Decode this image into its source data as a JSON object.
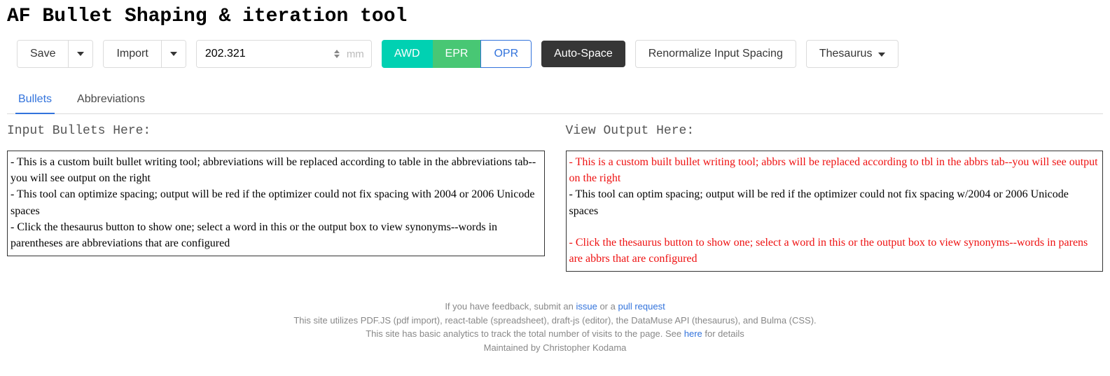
{
  "title": "AF Bullet Shaping & iteration tool",
  "toolbar": {
    "save": "Save",
    "import": "Import",
    "width_value": "202.321",
    "width_unit": "mm",
    "seg": {
      "awd": "AWD",
      "epr": "EPR",
      "opr": "OPR"
    },
    "autospace": "Auto-Space",
    "renormalize": "Renormalize Input Spacing",
    "thesaurus": "Thesaurus"
  },
  "tabs": {
    "bullets": "Bullets",
    "abbrs": "Abbreviations"
  },
  "input": {
    "label": "Input Bullets Here:",
    "text": "- This is a custom built bullet writing tool; abbreviations will be replaced according to table in the abbreviations tab--you will see output on the right\n- This tool can optimize spacing; output will be red if the optimizer could not fix spacing with 2004 or 2006 Unicode spaces\n- Click the thesaurus button to show one; select a word in this or the output box to view synonyms--words in parentheses are abbreviations that are configured"
  },
  "output": {
    "label": "View Output Here:",
    "lines": [
      {
        "text": "- This is a custom built bullet writing tool; abbrs will be replaced according to tbl in the abbrs tab--you will see output on the right",
        "err": true
      },
      {
        "text": "- This tool can optim spacing; output will be red if the optimizer could not fix spacing w/2004 or 2006 Unicode spaces",
        "err": false
      },
      {
        "text": "",
        "err": false
      },
      {
        "text": "- Click the thesaurus button to show one; select a word in this or the output box to view synonyms--words in parens are abbrs that are configured",
        "err": true
      }
    ]
  },
  "footer": {
    "l1a": "If you have feedback, submit an ",
    "l1_issue": "issue",
    "l1b": " or a ",
    "l1_pr": "pull request",
    "l2": "This site utilizes PDF.JS (pdf import), react-table (spreadsheet), draft-js (editor), the DataMuse API (thesaurus), and Bulma (CSS).",
    "l3a": "This site has basic analytics to track the total number of visits to the page. See ",
    "l3_here": "here",
    "l3b": " for details",
    "l4": "Maintained by Christopher Kodama"
  }
}
